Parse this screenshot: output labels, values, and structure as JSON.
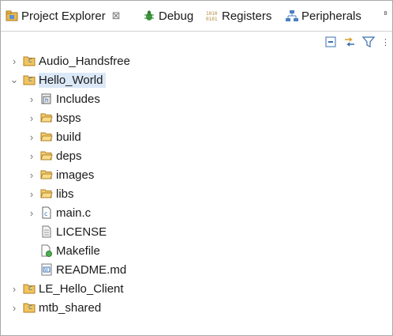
{
  "tabs": [
    {
      "label": "Project Explorer",
      "icon": "project-explorer-icon",
      "close": "⊠",
      "active": true
    },
    {
      "label": "Debug",
      "icon": "debug-icon"
    },
    {
      "label": "Registers",
      "icon": "registers-icon"
    },
    {
      "label": "Peripherals",
      "icon": "peripherals-icon"
    }
  ],
  "view_menu_glyph": "⁸",
  "toolbar": {
    "collapse_all": "collapse-all-icon",
    "link_with_editor": "link-with-editor-icon",
    "filter": "filter-icon",
    "more": "⋮"
  },
  "tree": [
    {
      "label": "Audio_Handsfree",
      "type": "project",
      "expanded": false,
      "level": 0
    },
    {
      "label": "Hello_World",
      "type": "project",
      "expanded": true,
      "level": 0,
      "selected": true
    },
    {
      "label": "Includes",
      "type": "includes",
      "expanded": false,
      "level": 1
    },
    {
      "label": "bsps",
      "type": "folder",
      "expanded": false,
      "level": 1
    },
    {
      "label": "build",
      "type": "folder",
      "expanded": false,
      "level": 1
    },
    {
      "label": "deps",
      "type": "folder",
      "expanded": false,
      "level": 1
    },
    {
      "label": "images",
      "type": "folder",
      "expanded": false,
      "level": 1
    },
    {
      "label": "libs",
      "type": "folder",
      "expanded": false,
      "level": 1
    },
    {
      "label": "main.c",
      "type": "c-file",
      "expanded": false,
      "level": 1
    },
    {
      "label": "LICENSE",
      "type": "text-file",
      "level": 1
    },
    {
      "label": "Makefile",
      "type": "makefile",
      "level": 1
    },
    {
      "label": "README.md",
      "type": "markdown-file",
      "level": 1
    },
    {
      "label": "LE_Hello_Client",
      "type": "project",
      "expanded": false,
      "level": 0
    },
    {
      "label": "mtb_shared",
      "type": "project",
      "expanded": false,
      "level": 0
    }
  ],
  "colors": {
    "selection": "#dbe8f7",
    "folder": "#e8b64a",
    "project": "#c8902c",
    "accent_blue": "#2f6fb5"
  }
}
